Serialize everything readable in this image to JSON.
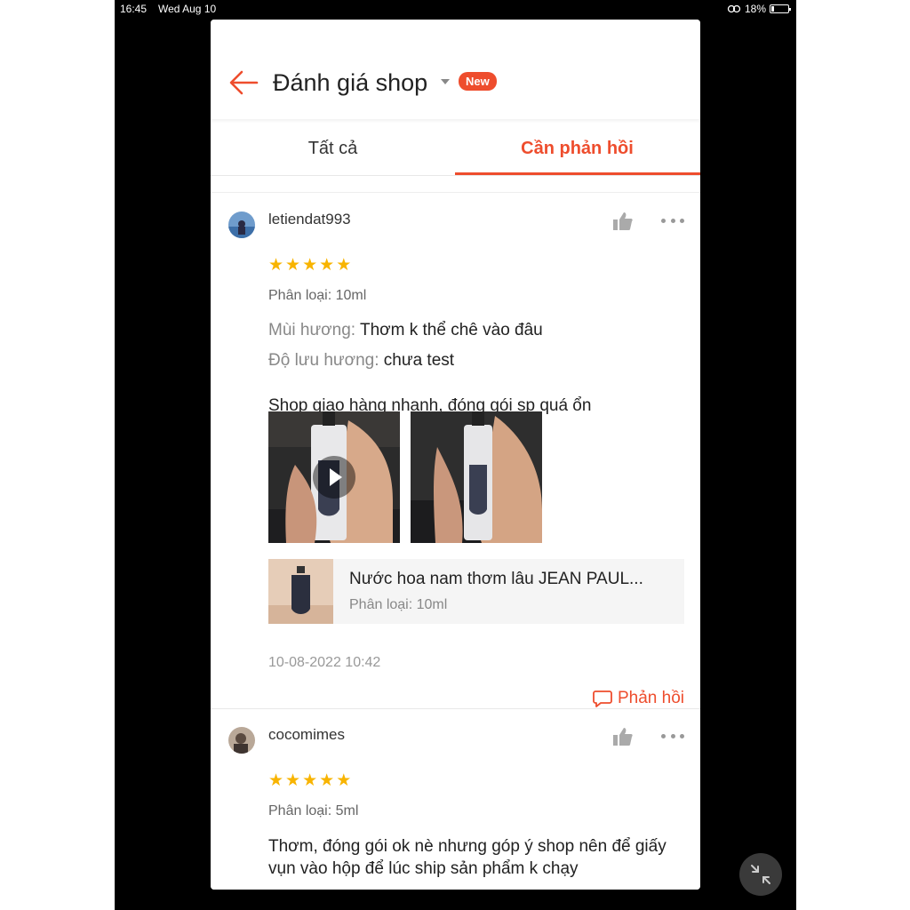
{
  "status_bar": {
    "time": "16:45",
    "date": "Wed Aug 10",
    "battery": "18%",
    "battery_level": 0.18
  },
  "header": {
    "title": "Đánh giá shop",
    "badge": "New",
    "back_icon": "arrow-left-icon",
    "dropdown_icon": "caret-down-icon"
  },
  "tabs": [
    {
      "label": "Tất cả",
      "active": false
    },
    {
      "label": "Cần phản hồi",
      "active": true
    }
  ],
  "colors": {
    "accent": "#ee4d2d",
    "star": "#f8b400",
    "card_bg": "#f5f5f5"
  },
  "reviews": [
    {
      "username": "letiendat993",
      "rating": 5,
      "variant": "Phân loại: 10ml",
      "attributes": [
        {
          "key": "Mùi hương:",
          "value": "Thơm k thể chê vào đâu"
        },
        {
          "key": "Độ lưu hương:",
          "value": "chưa test"
        }
      ],
      "comment": "Shop giao hàng nhanh, đóng gói sp quá ổn",
      "media": [
        {
          "type": "video"
        },
        {
          "type": "image"
        }
      ],
      "product": {
        "name": "Nước hoa nam thơm lâu JEAN PAUL...",
        "variant": "Phân loại: 10ml"
      },
      "timestamp": "10-08-2022 10:42",
      "reply_label": "Phản hồi"
    },
    {
      "username": "cocomimes",
      "rating": 5,
      "variant": "Phân loại: 5ml",
      "comment": "Thơm, đóng gói ok nè nhưng góp ý shop nên để giấy vụn vào hộp để lúc ship sản phẩm k chạy",
      "media": [
        {
          "type": "image"
        },
        {
          "type": "image"
        }
      ]
    }
  ],
  "icons": {
    "like": "thumbs-up-icon",
    "more": "more-dots-icon",
    "reply": "chat-bubble-icon",
    "collapse": "collapse-icon"
  }
}
